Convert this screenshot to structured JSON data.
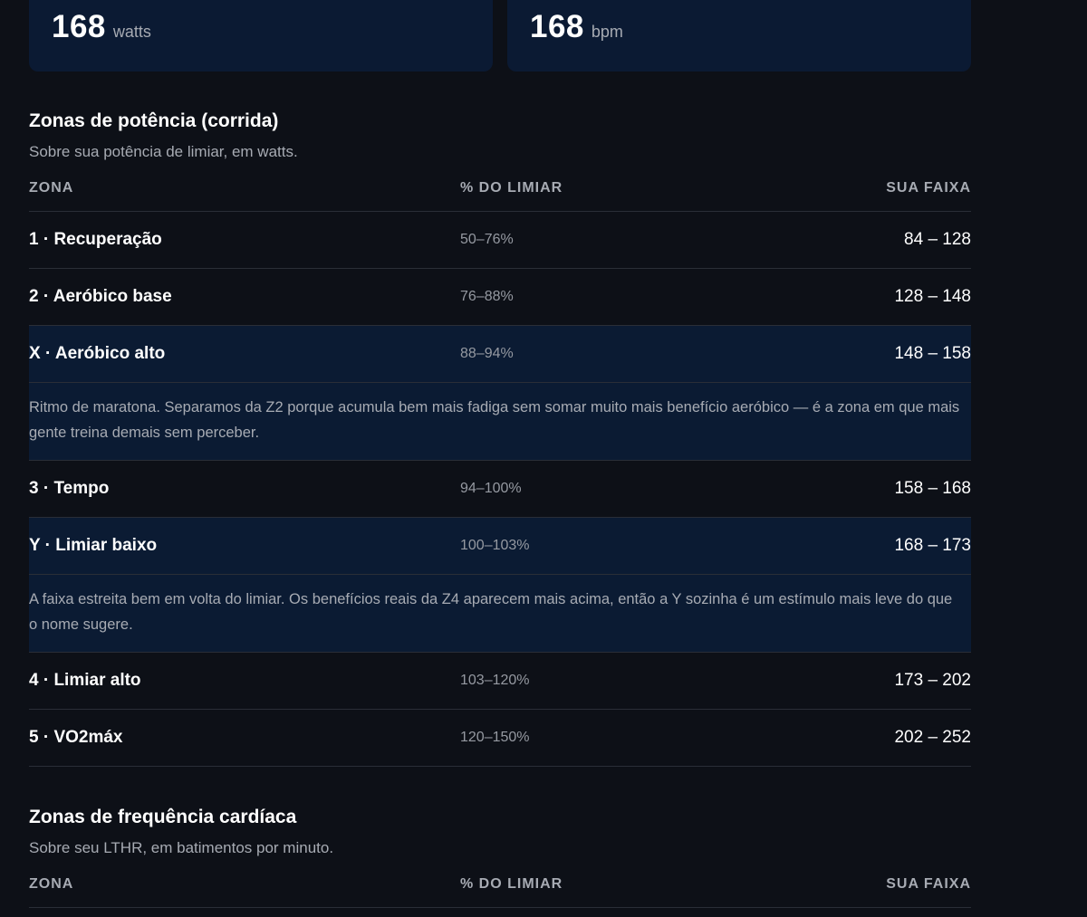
{
  "stats": [
    {
      "value": "168",
      "unit": "watts"
    },
    {
      "value": "168",
      "unit": "bpm"
    }
  ],
  "power_section": {
    "title": "Zonas de potência (corrida)",
    "subtitle": "Sobre sua potência de limiar, em watts.",
    "headers": {
      "zone": "ZONA",
      "pct": "% DO LIMIAR",
      "range": "SUA FAIXA"
    },
    "rows": [
      {
        "zone": "1 · Recuperação",
        "pct": "50–76%",
        "range": "84 – 128"
      },
      {
        "zone": "2 · Aeróbico base",
        "pct": "76–88%",
        "range": "128 – 148"
      },
      {
        "zone": "X · Aeróbico alto",
        "pct": "88–94%",
        "range": "148 – 158",
        "note": "Ritmo de maratona. Separamos da Z2 porque acumula bem mais fadiga sem somar muito mais benefício aeróbico — é a zona em que mais gente treina demais sem perceber."
      },
      {
        "zone": "3 · Tempo",
        "pct": "94–100%",
        "range": "158 – 168"
      },
      {
        "zone": "Y · Limiar baixo",
        "pct": "100–103%",
        "range": "168 – 173",
        "note": "A faixa estreita bem em volta do limiar. Os benefícios reais da Z4 aparecem mais acima, então a Y sozinha é um estímulo mais leve do que o nome sugere."
      },
      {
        "zone": "4 · Limiar alto",
        "pct": "103–120%",
        "range": "173 – 202"
      },
      {
        "zone": "5 · VO2máx",
        "pct": "120–150%",
        "range": "202 – 252"
      }
    ]
  },
  "hr_section": {
    "title": "Zonas de frequência cardíaca",
    "subtitle": "Sobre seu LTHR, em batimentos por minuto.",
    "headers": {
      "zone": "ZONA",
      "pct": "% DO LIMIAR",
      "range": "SUA FAIXA"
    }
  }
}
